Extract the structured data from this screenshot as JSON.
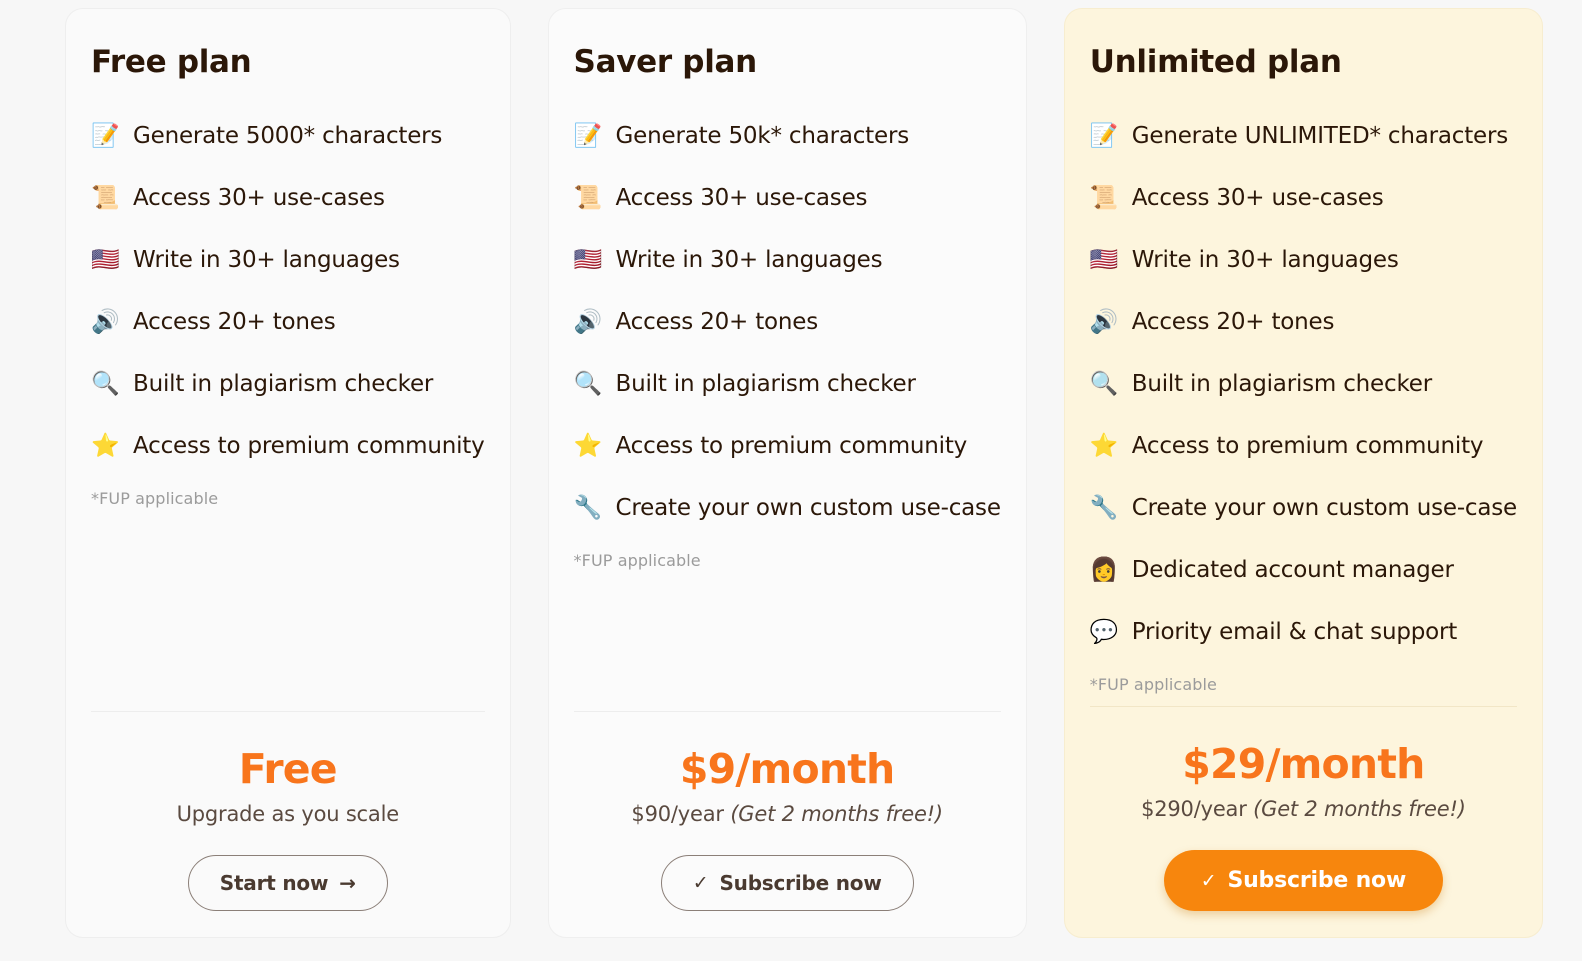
{
  "theme": {
    "page_background": "#f7f7f7",
    "accent_orange": "#f8751c",
    "button_orange": "#f7860d",
    "highlight_card_background": "#fdf5dd",
    "text_dark": "#2b1708",
    "text_muted": "#9b9b9b"
  },
  "plans": [
    {
      "id": "free",
      "title": "Free plan",
      "features": [
        {
          "icon": "memo-icon",
          "glyph": "📝",
          "label": "Generate 5000* characters"
        },
        {
          "icon": "scroll-icon",
          "glyph": "📜",
          "label": "Access 30+ use-cases"
        },
        {
          "icon": "us-flag-icon",
          "glyph": "🇺🇸",
          "label": "Write in 30+ languages"
        },
        {
          "icon": "speaker-icon",
          "glyph": "🔊",
          "label": "Access 20+ tones"
        },
        {
          "icon": "magnifier-icon",
          "glyph": "🔍",
          "label": "Built in plagiarism checker"
        },
        {
          "icon": "star-icon",
          "glyph": "⭐",
          "label": "Access to premium community"
        }
      ],
      "footnote": "*FUP applicable",
      "price_main": "Free",
      "price_sub": "Upgrade as you scale",
      "price_sub_promo": "",
      "cta_label": "Start now",
      "cta_style": "outline",
      "cta_icon": "arrow-right-icon",
      "cta_glyph": "→"
    },
    {
      "id": "saver",
      "title": "Saver plan",
      "features": [
        {
          "icon": "memo-icon",
          "glyph": "📝",
          "label": "Generate 50k* characters"
        },
        {
          "icon": "scroll-icon",
          "glyph": "📜",
          "label": "Access 30+ use-cases"
        },
        {
          "icon": "us-flag-icon",
          "glyph": "🇺🇸",
          "label": "Write in 30+ languages"
        },
        {
          "icon": "speaker-icon",
          "glyph": "🔊",
          "label": "Access 20+ tones"
        },
        {
          "icon": "magnifier-icon",
          "glyph": "🔍",
          "label": "Built in plagiarism checker"
        },
        {
          "icon": "star-icon",
          "glyph": "⭐",
          "label": "Access to premium community"
        },
        {
          "icon": "wrench-icon",
          "glyph": "🔧",
          "label": "Create your own custom use-case"
        }
      ],
      "footnote": "*FUP applicable",
      "price_main": "$9/month",
      "price_sub": "$90/year ",
      "price_sub_promo": "(Get 2 months free!)",
      "cta_label": "Subscribe now",
      "cta_style": "outline",
      "cta_icon": "check-icon",
      "cta_glyph": "✓"
    },
    {
      "id": "unlimited",
      "title": "Unlimited plan",
      "features": [
        {
          "icon": "memo-icon",
          "glyph": "📝",
          "label": "Generate UNLIMITED* characters"
        },
        {
          "icon": "scroll-icon",
          "glyph": "📜",
          "label": "Access 30+ use-cases"
        },
        {
          "icon": "us-flag-icon",
          "glyph": "🇺🇸",
          "label": "Write in 30+ languages"
        },
        {
          "icon": "speaker-icon",
          "glyph": "🔊",
          "label": "Access 20+ tones"
        },
        {
          "icon": "magnifier-icon",
          "glyph": "🔍",
          "label": "Built in plagiarism checker"
        },
        {
          "icon": "star-icon",
          "glyph": "⭐",
          "label": "Access to premium community"
        },
        {
          "icon": "wrench-icon",
          "glyph": "🔧",
          "label": "Create your own custom use-case"
        },
        {
          "icon": "account-manager-icon",
          "glyph": "👩",
          "label": "Dedicated account manager"
        },
        {
          "icon": "speech-balloon-icon",
          "glyph": "💬",
          "label": "Priority email & chat support"
        }
      ],
      "footnote": "*FUP applicable",
      "price_main": "$29/month",
      "price_sub": "$290/year ",
      "price_sub_promo": "(Get 2 months free!)",
      "cta_label": "Subscribe now",
      "cta_style": "filled",
      "cta_icon": "check-icon",
      "cta_glyph": "✓"
    }
  ]
}
